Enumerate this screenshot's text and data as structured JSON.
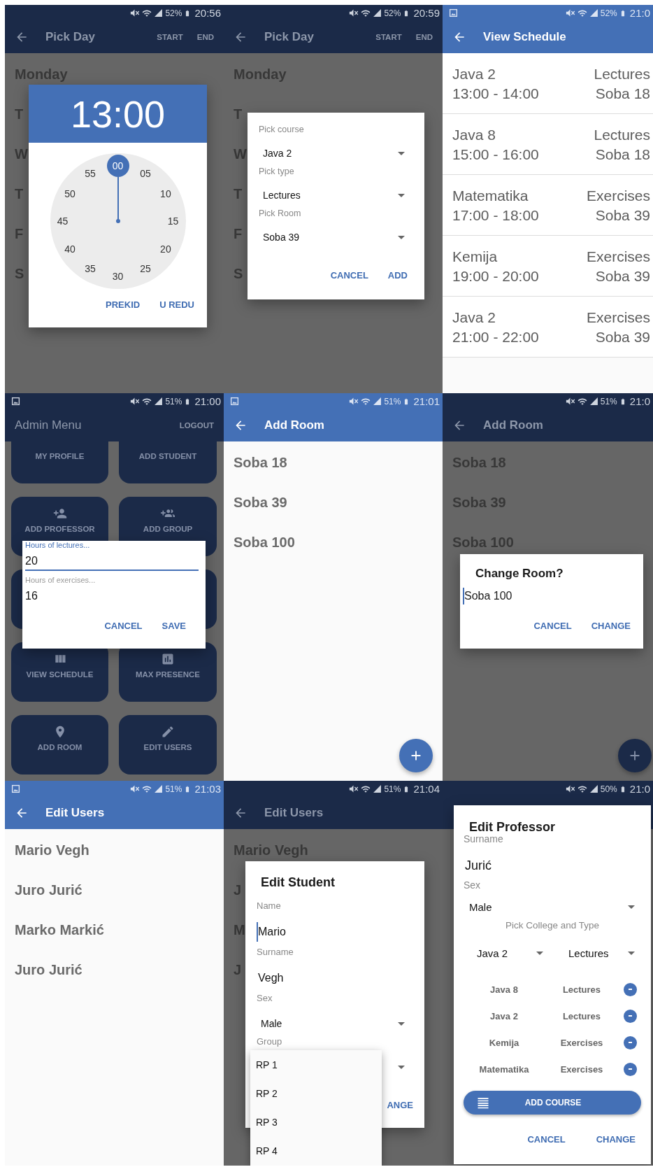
{
  "screens": [
    {
      "status": {
        "screenshot_icon": false,
        "battery": "52%",
        "time": "20:56"
      },
      "app_bar": {
        "back": true,
        "title": "Pick Day",
        "actions": [
          "START",
          "END"
        ]
      },
      "content": {
        "kind": "days",
        "items": [
          "Monday",
          "T",
          "W",
          "T",
          "F",
          "S"
        ]
      },
      "dialog": {
        "kind": "time_picker",
        "time": "13:00",
        "dial": [
          {
            "label": "00",
            "selected": true
          },
          {
            "label": "05",
            "selected": false
          },
          {
            "label": "10",
            "selected": false
          },
          {
            "label": "15",
            "selected": false
          },
          {
            "label": "20",
            "selected": false
          },
          {
            "label": "25",
            "selected": false
          },
          {
            "label": "30",
            "selected": false
          },
          {
            "label": "35",
            "selected": false
          },
          {
            "label": "40",
            "selected": false
          },
          {
            "label": "45",
            "selected": false
          },
          {
            "label": "50",
            "selected": false
          },
          {
            "label": "55",
            "selected": false
          }
        ],
        "buttons": [
          "PREKID",
          "U REDU"
        ]
      }
    },
    {
      "status": {
        "screenshot_icon": false,
        "battery": "52%",
        "time": "20:59"
      },
      "app_bar": {
        "back": true,
        "title": "Pick Day",
        "actions": [
          "START",
          "END"
        ]
      },
      "content": {
        "kind": "days",
        "items": [
          "Monday",
          "T",
          "W",
          "T",
          "F",
          "S"
        ]
      },
      "dialog": {
        "kind": "pick_course",
        "fields": [
          {
            "label": "Pick course",
            "value": "Java 2"
          },
          {
            "label": "Pick type",
            "value": "Lectures"
          },
          {
            "label": "Pick Room",
            "value": "Soba 39"
          }
        ],
        "buttons": [
          "CANCEL",
          "ADD"
        ]
      }
    },
    {
      "status": {
        "screenshot_icon": true,
        "battery": "52%",
        "time": "21:0"
      },
      "app_bar": {
        "back": true,
        "title": "View Schedule"
      },
      "content": {
        "kind": "schedule",
        "items": [
          {
            "course": "Java 2",
            "time": "13:00 - 14:00",
            "type": "Lectures",
            "room": "Soba 18"
          },
          {
            "course": "Java 8",
            "time": "15:00 - 16:00",
            "type": "Lectures",
            "room": "Soba 18"
          },
          {
            "course": "Matematika",
            "time": "17:00 - 18:00",
            "type": "Exercises",
            "room": "Soba 39"
          },
          {
            "course": "Kemija",
            "time": "19:00 - 20:00",
            "type": "Exercises",
            "room": "Soba 39"
          },
          {
            "course": "Java 2",
            "time": "21:00 - 22:00",
            "type": "Exercises",
            "room": "Soba 39"
          }
        ]
      }
    },
    {
      "status": {
        "screenshot_icon": true,
        "battery": "51%",
        "time": "21:00"
      },
      "app_bar": {
        "back": false,
        "title": "Admin Menu",
        "actions": [
          "LOGOUT"
        ]
      },
      "content": {
        "kind": "tiles",
        "items": [
          {
            "kind": "labeled",
            "label": "MY PROFILE"
          },
          {
            "kind": "labeled",
            "label": "ADD STUDENT"
          },
          {
            "kind": "labeled",
            "label": "ADD PROFESSOR"
          },
          {
            "kind": "labeled",
            "label": "ADD GROUP"
          },
          {
            "kind": "blank"
          },
          {
            "kind": "blank"
          },
          {
            "kind": "labeled",
            "label": "VIEW SCHEDULE"
          },
          {
            "kind": "labeled",
            "label": "MAX PRESENCE"
          },
          {
            "kind": "labeled",
            "label": "ADD ROOM"
          },
          {
            "kind": "labeled",
            "label": "EDIT USERS"
          }
        ]
      },
      "dialog": {
        "kind": "hours",
        "fields": [
          {
            "label": "Hours of lectures...",
            "value": "20",
            "focused": true
          },
          {
            "label": "Hours of exercises...",
            "value": "16",
            "focused": false
          }
        ],
        "buttons": [
          "CANCEL",
          "SAVE"
        ]
      }
    },
    {
      "status": {
        "screenshot_icon": true,
        "battery": "51%",
        "time": "21:01"
      },
      "app_bar": {
        "back": true,
        "title": "Add Room"
      },
      "content": {
        "kind": "rooms",
        "items": [
          "Soba 18",
          "Soba 39",
          "Soba 100"
        ]
      },
      "fab": true
    },
    {
      "status": {
        "screenshot_icon": false,
        "battery": "51%",
        "time": "21:0"
      },
      "app_bar": {
        "back": true,
        "title": "Add Room"
      },
      "content": {
        "kind": "rooms",
        "items": [
          "Soba 18",
          "Soba 39",
          "Soba 100"
        ]
      },
      "fab": true,
      "dialog": {
        "kind": "change_room",
        "title": "Change Room?",
        "fields": [
          {
            "value": "Soba 100",
            "focused": true
          }
        ],
        "buttons": [
          "CANCEL",
          "CHANGE"
        ]
      }
    },
    {
      "status": {
        "screenshot_icon": true,
        "battery": "51%",
        "time": "21:03"
      },
      "app_bar": {
        "back": true,
        "title": "Edit Users"
      },
      "content": {
        "kind": "users",
        "items": [
          "Mario Vegh",
          "Juro Jurić",
          "Marko Markić",
          "Juro Jurić"
        ]
      }
    },
    {
      "status": {
        "screenshot_icon": false,
        "battery": "51%",
        "time": "21:04"
      },
      "app_bar": {
        "back": true,
        "title": "Edit Users"
      },
      "content": {
        "kind": "users",
        "items": [
          "Mario Vegh",
          "J",
          "M",
          "J"
        ]
      },
      "dialog": {
        "kind": "edit_student",
        "title": "Edit Student",
        "fields": [
          {
            "kind": "text",
            "label": "Name",
            "value": "Mario",
            "focused": true
          },
          {
            "kind": "text",
            "label": "Surname",
            "value": "Vegh",
            "focused": false
          },
          {
            "kind": "select",
            "label": "Sex",
            "value": "Male"
          },
          {
            "kind": "select",
            "label": "Group"
          }
        ],
        "buttons": [
          "ANGE"
        ],
        "menu": [
          "RP 1",
          "RP 2",
          "RP 3",
          "RP 4"
        ]
      }
    },
    {
      "status": {
        "screenshot_icon": false,
        "battery": "50%",
        "time": "21:0"
      },
      "dialog": {
        "kind": "edit_professor",
        "title": "Edit Professor",
        "fields": [
          {
            "kind": "text",
            "label": "Surname",
            "value": "Jurić",
            "focused": false
          },
          {
            "kind": "select",
            "label": "Sex",
            "value": "Male"
          }
        ],
        "section": "Pick College and Type",
        "pickers": [
          "Java 2",
          "Lectures"
        ],
        "courses": [
          {
            "course": "Java 8",
            "type": "Lectures"
          },
          {
            "course": "Java 2",
            "type": "Lectures"
          },
          {
            "course": "Kemija",
            "type": "Exercises"
          },
          {
            "course": "Matematika",
            "type": "Exercises"
          }
        ],
        "add_button": "ADD COURSE",
        "buttons": [
          "CANCEL",
          "CHANGE"
        ]
      }
    }
  ]
}
